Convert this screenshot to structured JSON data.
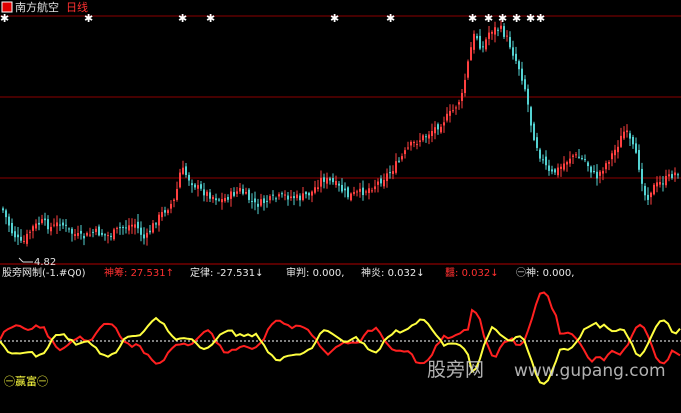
{
  "main_panel": {
    "stock_name": "南方航空",
    "period": "日线",
    "low_marker_label": "4.82"
  },
  "indicator_bar": {
    "name": "股旁网制(-1.#Q0)",
    "items": [
      {
        "label": "神筹",
        "value": "27.531",
        "arrow": "↑",
        "color": "#ff3030"
      },
      {
        "label": "定律",
        "value": "-27.531",
        "arrow": "↓",
        "color": "#e8e8e8"
      },
      {
        "label": "审判",
        "value": "0.000,",
        "arrow": "",
        "color": "#e8e8e8"
      },
      {
        "label": "神炎",
        "value": "0.032",
        "arrow": "↓",
        "color": "#e8e8e8"
      },
      {
        "label": "䨻",
        "value": "0.032",
        "arrow": "↓",
        "color": "#ff3030"
      },
      {
        "label": "㊀神",
        "value": "0.000,",
        "arrow": "",
        "color": "#e8e8e8"
      }
    ]
  },
  "bottom_panel": {
    "label": "㊀赢富㊀"
  },
  "watermark": {
    "text_cn": "股旁网",
    "text_url": "www.gupang.com"
  },
  "colors": {
    "background": "#000000",
    "up_candle": "#ff4040",
    "down_candle": "#54d2d2",
    "grid": "#8b0000",
    "red_line": "#ff2020",
    "yellow_line": "#ffff40",
    "baseline": "#ffffff"
  },
  "icons": {
    "stock_badge": "red-square-icon",
    "signal_marker": "star-marker-icon"
  }
}
